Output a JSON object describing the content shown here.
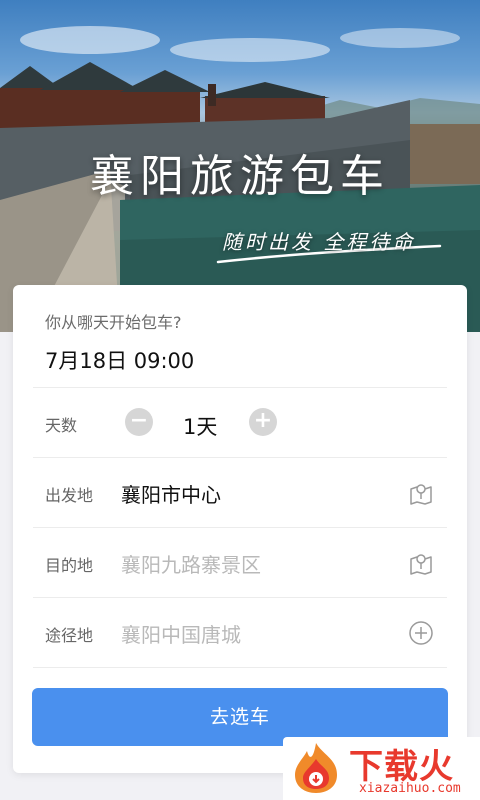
{
  "hero": {
    "title": "襄阳旅游包车",
    "slogan": "随时出发 全程待命"
  },
  "form": {
    "start_question": "你从哪天开始包车?",
    "start_value": "7月18日  09:00",
    "days": {
      "label": "天数",
      "value": "1天",
      "minus": "−",
      "plus": "+"
    },
    "departure": {
      "label": "出发地",
      "value": "襄阳市中心",
      "icon": "map-pin-icon"
    },
    "destination": {
      "label": "目的地",
      "placeholder": "襄阳九路寨景区",
      "icon": "map-pin-icon"
    },
    "waypoint": {
      "label": "途径地",
      "placeholder": "襄阳中国唐城",
      "icon": "add-circle-icon"
    },
    "submit_label": "去选车"
  },
  "watermark": {
    "brand": "下载火",
    "domain": "xiazaihuo.com"
  },
  "colors": {
    "accent": "#4a90ee",
    "watermark": "#e8392d"
  }
}
